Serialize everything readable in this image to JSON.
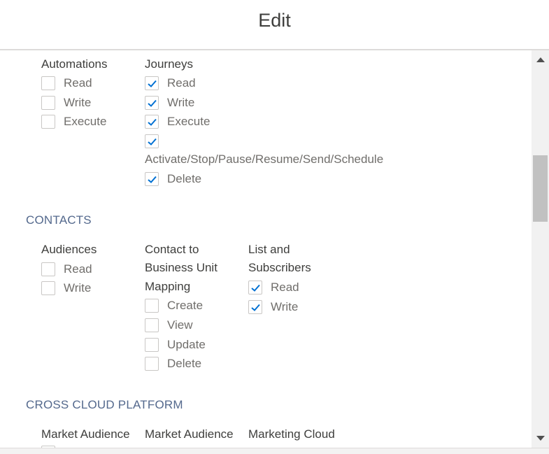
{
  "header": {
    "title": "Edit"
  },
  "sections": {
    "top": {
      "automations": {
        "label": "Automations",
        "items": [
          {
            "label": "Read",
            "checked": false
          },
          {
            "label": "Write",
            "checked": false
          },
          {
            "label": "Execute",
            "checked": false
          }
        ]
      },
      "journeys": {
        "label": "Journeys",
        "items": [
          {
            "label": "Read",
            "checked": true
          },
          {
            "label": "Write",
            "checked": true
          },
          {
            "label": "Execute",
            "checked": true
          },
          {
            "label": "Activate/Stop/Pause/Resume/Send/Schedule",
            "checked": true
          },
          {
            "label": "Delete",
            "checked": true
          }
        ]
      }
    },
    "contacts": {
      "title": "CONTACTS",
      "audiences": {
        "label": "Audiences",
        "items": [
          {
            "label": "Read",
            "checked": false
          },
          {
            "label": "Write",
            "checked": false
          }
        ]
      },
      "contact_bu_mapping": {
        "label_lines": [
          "Contact to",
          "Business Unit",
          "Mapping"
        ],
        "items": [
          {
            "label": "Create",
            "checked": false
          },
          {
            "label": "View",
            "checked": false
          },
          {
            "label": "Update",
            "checked": false
          },
          {
            "label": "Delete",
            "checked": false
          }
        ]
      },
      "list_subscribers": {
        "label_lines": [
          "List and",
          "Subscribers"
        ],
        "items": [
          {
            "label": "Read",
            "checked": true
          },
          {
            "label": "Write",
            "checked": true
          }
        ]
      }
    },
    "cross_cloud": {
      "title": "CROSS CLOUD PLATFORM",
      "groups": [
        "Market Audience",
        "Market Audience",
        "Marketing Cloud"
      ]
    }
  },
  "colors": {
    "section_title": "#54698d",
    "check": "#0070d2",
    "checkbox_border": "#c9c7c5"
  }
}
